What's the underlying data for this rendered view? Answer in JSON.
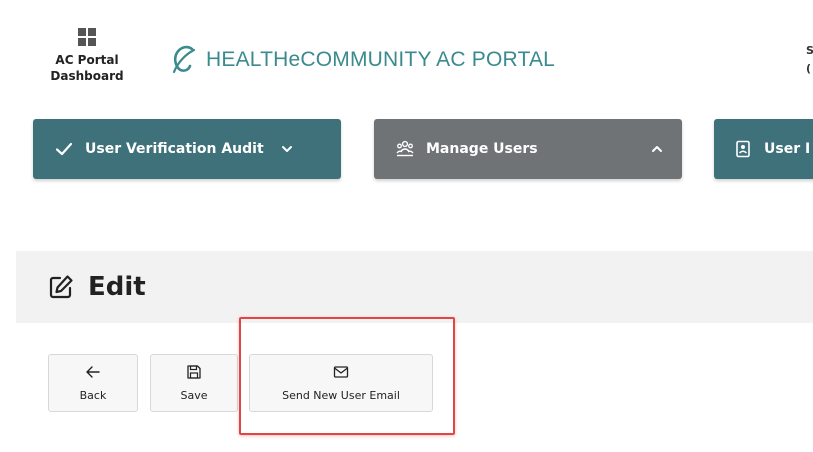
{
  "header": {
    "dashboard_label_line1": "AC Portal",
    "dashboard_label_line2": "Dashboard",
    "brand_title": "HEALTHeCOMMUNITY AC PORTAL",
    "brand_color": "#3a8a8e",
    "cut_text_1": "S",
    "cut_text_2": "("
  },
  "nav": {
    "items": [
      {
        "label": "User Verification Audit",
        "icon": "check-icon",
        "chevron": "chevron-down-icon",
        "color": "#3e7179"
      },
      {
        "label": "Manage Users",
        "icon": "users-icon",
        "chevron": "chevron-up-icon",
        "color": "#6f7376"
      },
      {
        "label": "User I",
        "icon": "document-icon",
        "color": "#3e7179"
      }
    ]
  },
  "panel": {
    "title": "Edit",
    "icon": "edit-icon"
  },
  "toolbar": {
    "back_label": "Back",
    "save_label": "Save",
    "email_label": "Send New User Email"
  },
  "highlight_color": "#e04646"
}
